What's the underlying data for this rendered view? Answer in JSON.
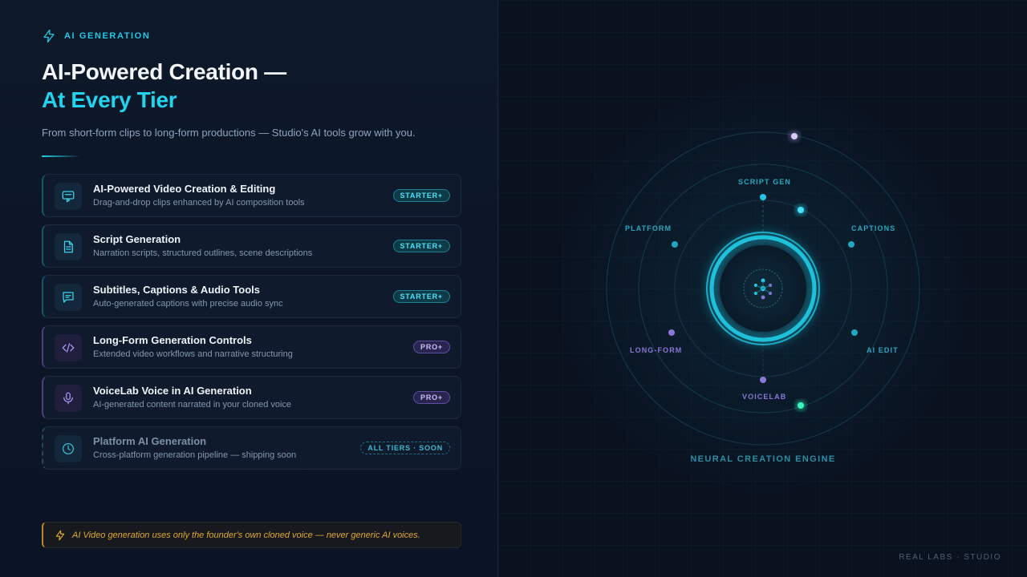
{
  "header": {
    "eyebrow": "AI GENERATION",
    "eyebrow_icon": "lightning-bolt-icon",
    "title_line1": "AI-Powered Creation —",
    "title_line2": "At Every Tier",
    "subtitle": "From short-form clips to long-form productions — Studio's AI tools grow with you."
  },
  "features": [
    {
      "title": "AI-Powered Video Creation & Editing",
      "desc": "Drag-and-drop clips enhanced by AI composition tools",
      "badge": "STARTER+",
      "icon": "video-edit-icon",
      "tier": "starter"
    },
    {
      "title": "Script Generation",
      "desc": "Narration scripts, structured outlines, scene descriptions",
      "badge": "STARTER+",
      "icon": "document-icon",
      "tier": "starter"
    },
    {
      "title": "Subtitles, Captions & Audio Tools",
      "desc": "Auto-generated captions with precise audio sync",
      "badge": "STARTER+",
      "icon": "caption-icon",
      "tier": "starter"
    },
    {
      "title": "Long-Form Generation Controls",
      "desc": "Extended video workflows and narrative structuring",
      "badge": "PRO+",
      "icon": "code-icon",
      "tier": "pro"
    },
    {
      "title": "VoiceLab Voice in AI Generation",
      "desc": "AI-generated content narrated in your cloned voice",
      "badge": "PRO+",
      "icon": "microphone-icon",
      "tier": "pro"
    },
    {
      "title": "Platform AI Generation",
      "desc": "Cross-platform generation pipeline — shipping soon",
      "badge": "ALL TIERS · SOON",
      "icon": "clock-icon",
      "tier": "soon"
    }
  ],
  "note": {
    "icon": "lightning-bolt-icon",
    "text": "AI Video generation uses only the founder's own cloned voice — never generic AI voices."
  },
  "diagram": {
    "engine_label": "NEURAL CREATION ENGINE",
    "nodes": {
      "script_gen": "SCRIPT GEN",
      "captions": "CAPTIONS",
      "platform": "PLATFORM",
      "ai_edit": "AI EDIT",
      "long_form": "LONG-FORM",
      "voicelab": "VOICELAB"
    }
  },
  "footer": "REAL LABS · STUDIO",
  "colors": {
    "accent_cyan": "#22d3ee",
    "accent_purple": "#8a78d6",
    "warning_amber": "#e0a92f",
    "background": "#0b1322"
  }
}
